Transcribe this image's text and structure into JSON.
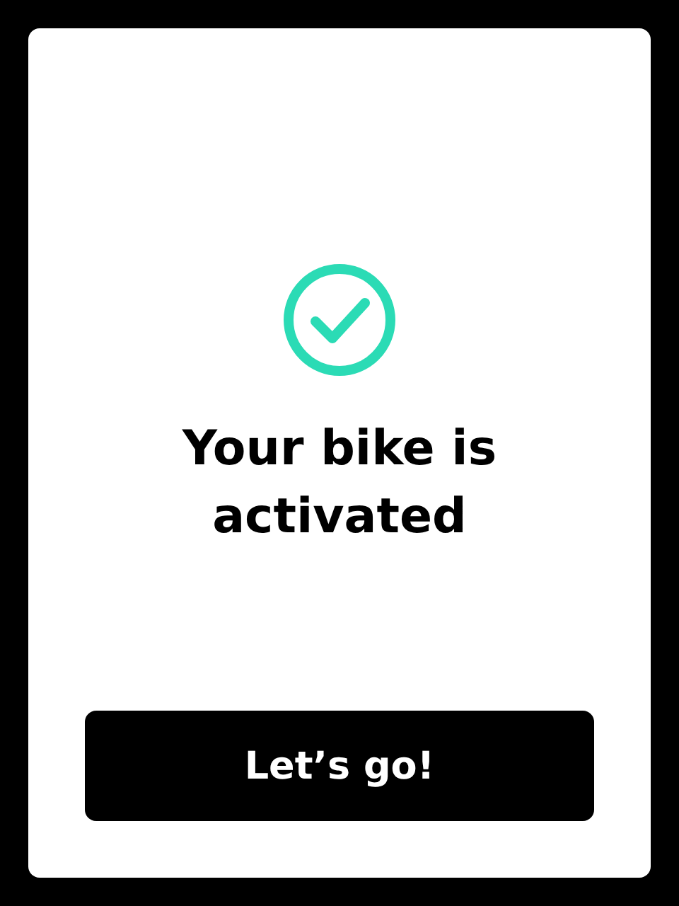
{
  "dialog": {
    "title": "Your bike is activated",
    "button": "Let’s go!"
  }
}
